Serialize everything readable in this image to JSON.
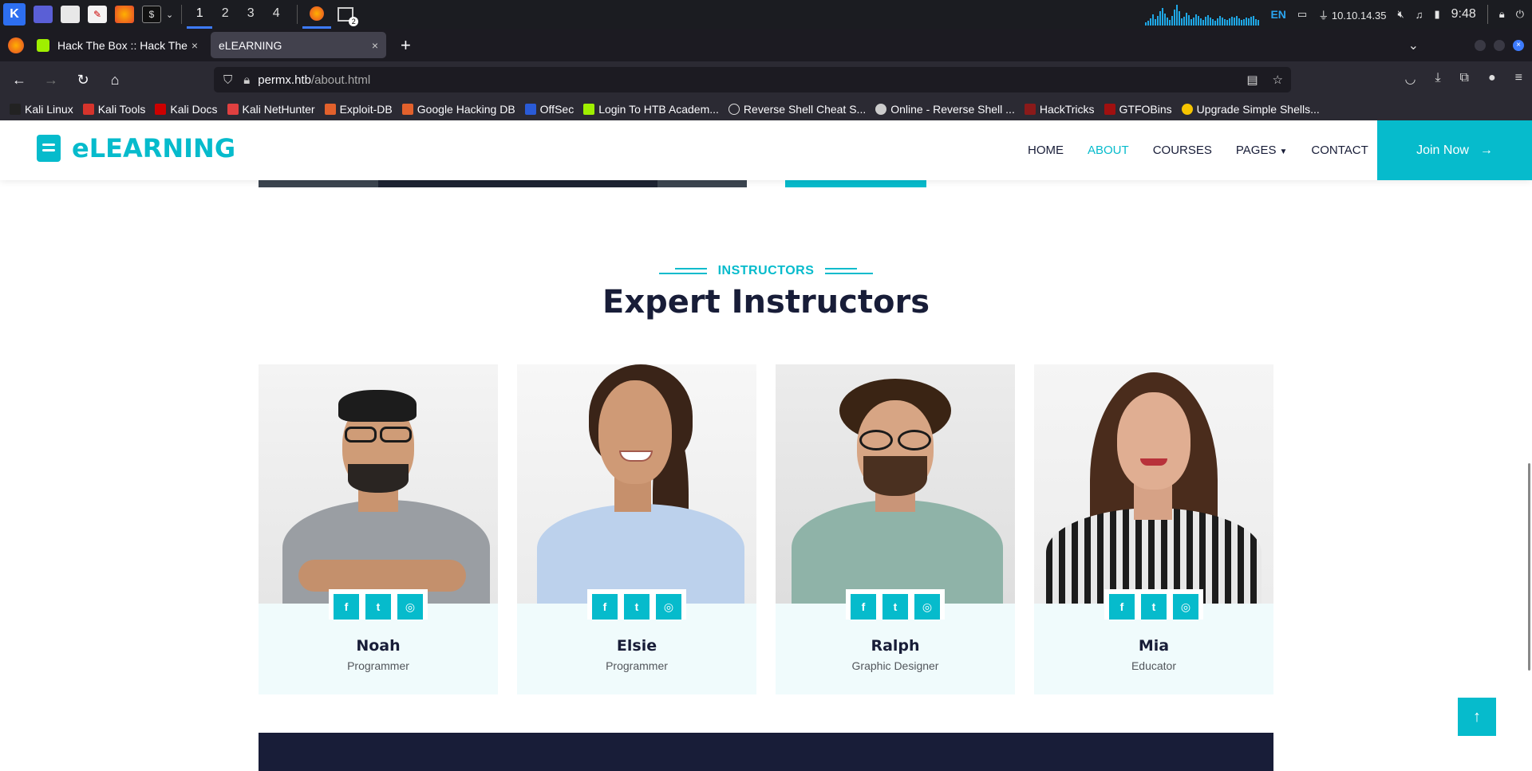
{
  "taskbar": {
    "workspaces": [
      "1",
      "2",
      "3",
      "4"
    ],
    "ip": "10.10.14.35",
    "lang": "EN",
    "clock": "9:48",
    "terminal_badge": "2"
  },
  "browser": {
    "tabs": [
      {
        "label": "Hack The Box :: Hack The",
        "close": "×"
      },
      {
        "label": "eLEARNING",
        "close": "×"
      }
    ],
    "new_tab": "+",
    "url_host": "permx.htb",
    "url_path": "/about.html",
    "bookmarks": [
      "Kali Linux",
      "Kali Tools",
      "Kali Docs",
      "Kali NetHunter",
      "Exploit-DB",
      "Google Hacking DB",
      "OffSec",
      "Login To HTB Academ...",
      "Reverse Shell Cheat S...",
      "Online - Reverse Shell ...",
      "HackTricks",
      "GTFOBins",
      "Upgrade Simple Shells..."
    ]
  },
  "site": {
    "brand": "eLEARNING",
    "menu": {
      "home": "HOME",
      "about": "ABOUT",
      "courses": "COURSES",
      "pages": "PAGES",
      "contact": "CONTACT"
    },
    "join": "Join Now",
    "section": {
      "eyebrow": "INSTRUCTORS",
      "heading": "Expert Instructors"
    },
    "instructors": [
      {
        "name": "Noah",
        "role": "Programmer"
      },
      {
        "name": "Elsie",
        "role": "Programmer"
      },
      {
        "name": "Ralph",
        "role": "Graphic Designer"
      },
      {
        "name": "Mia",
        "role": "Educator"
      }
    ]
  },
  "colors": {
    "accent": "#06bbcc",
    "dark": "#181d38",
    "card_bg": "#f0fbfc"
  }
}
